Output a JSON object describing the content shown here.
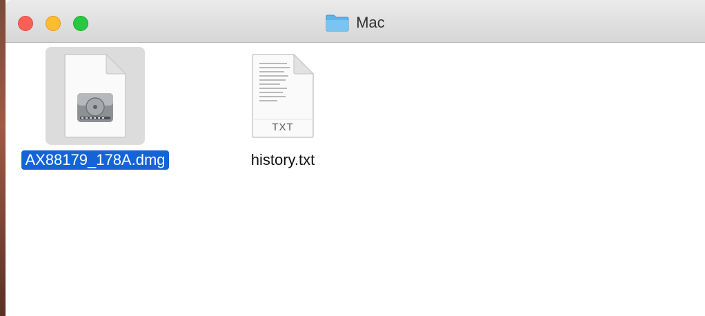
{
  "window": {
    "title": "Mac"
  },
  "files": [
    {
      "name": "AX88179_178A.dmg",
      "icon": "disk-image-icon",
      "selected": true
    },
    {
      "name": "history.txt",
      "icon": "text-document-icon",
      "badge": "TXT",
      "selected": false
    }
  ],
  "colors": {
    "selection": "#1464d8",
    "close": "#fc5f57",
    "minimize": "#fdbc2e",
    "zoom": "#28c840"
  }
}
